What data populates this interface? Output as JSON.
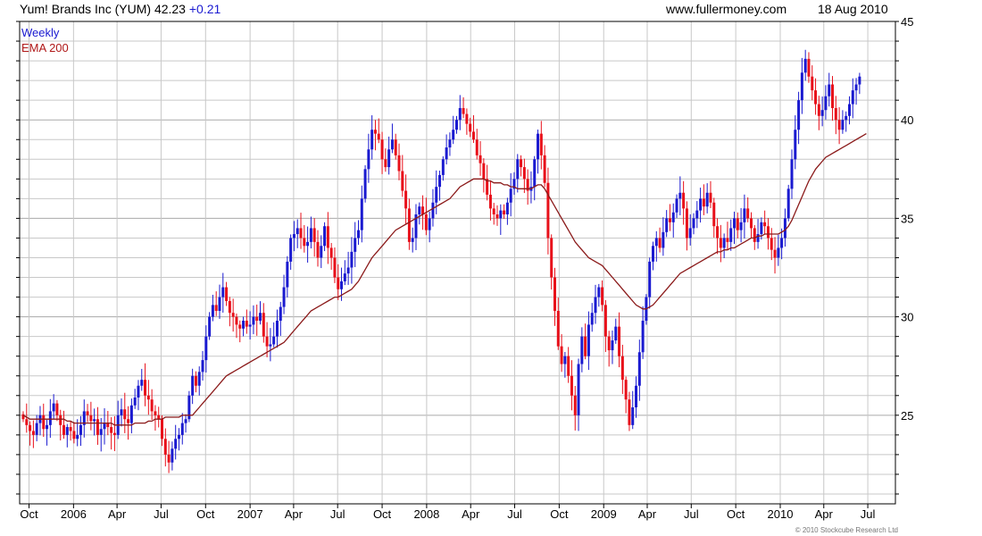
{
  "header": {
    "title": "Yum! Brands Inc (YUM)",
    "price": "42.23",
    "change": "+0.21",
    "website": "www.fullermoney.com",
    "date": "18 Aug 2010"
  },
  "legend": [
    {
      "label": "Weekly",
      "color": "#1a1ad0"
    },
    {
      "label": "EMA 200",
      "color": "#b01818"
    }
  ],
  "copyright": "© 2010 Stockcube Research Ltd",
  "colors": {
    "up": "#1a1ad0",
    "down": "#e8101a",
    "ema": "#8b1a1a",
    "grid": "#c8c8c8",
    "grid_major": "#aaaaaa"
  },
  "chart_data": {
    "type": "candlestick",
    "interval": "weekly",
    "x_range": [
      "2005-09-19",
      "2010-08-16"
    ],
    "x_tick_labels": [
      {
        "date": "2005-10-01",
        "label": "Oct"
      },
      {
        "date": "2006-01-01",
        "label": "2006"
      },
      {
        "date": "2006-04-01",
        "label": "Apr"
      },
      {
        "date": "2006-07-01",
        "label": "Jul"
      },
      {
        "date": "2006-10-01",
        "label": "Oct"
      },
      {
        "date": "2007-01-01",
        "label": "2007"
      },
      {
        "date": "2007-04-01",
        "label": "Apr"
      },
      {
        "date": "2007-07-01",
        "label": "Jul"
      },
      {
        "date": "2007-10-01",
        "label": "Oct"
      },
      {
        "date": "2008-01-01",
        "label": "2008"
      },
      {
        "date": "2008-04-01",
        "label": "Apr"
      },
      {
        "date": "2008-07-01",
        "label": "Jul"
      },
      {
        "date": "2008-10-01",
        "label": "Oct"
      },
      {
        "date": "2009-01-01",
        "label": "2009"
      },
      {
        "date": "2009-04-01",
        "label": "Apr"
      },
      {
        "date": "2009-07-01",
        "label": "Jul"
      },
      {
        "date": "2009-10-01",
        "label": "Oct"
      },
      {
        "date": "2010-01-01",
        "label": "2010"
      },
      {
        "date": "2010-04-01",
        "label": "Apr"
      },
      {
        "date": "2010-07-01",
        "label": "Jul"
      }
    ],
    "y_range": [
      20.5,
      45
    ],
    "y_ticks": [
      25,
      30,
      35,
      40,
      45
    ],
    "y_minor_step": 1,
    "y_axis_side": "right",
    "grid": true,
    "legend_position": "top-left",
    "weekly_close_series": {
      "start_date": "2005-09-19",
      "interval_days": 7,
      "closes": [
        24.8,
        24.5,
        24.2,
        24.0,
        24.6,
        25.0,
        24.3,
        24.5,
        25.2,
        25.6,
        25.0,
        24.5,
        24.0,
        24.4,
        24.2,
        23.8,
        24.0,
        24.5,
        25.2,
        25.0,
        24.7,
        24.8,
        24.0,
        24.3,
        24.6,
        24.4,
        24.1,
        24.0,
        25.0,
        25.3,
        24.8,
        24.6,
        25.5,
        25.9,
        26.5,
        26.8,
        26.0,
        25.8,
        25.2,
        25.0,
        24.8,
        23.8,
        23.0,
        22.6,
        23.3,
        23.8,
        24.0,
        24.6,
        24.8,
        26.0,
        27.0,
        26.5,
        27.2,
        27.8,
        29.0,
        30.0,
        30.6,
        30.3,
        31.0,
        31.5,
        30.8,
        30.2,
        30.0,
        29.6,
        29.4,
        29.8,
        29.5,
        29.6,
        30.0,
        29.8,
        30.2,
        29.0,
        28.5,
        28.6,
        29.0,
        29.8,
        30.5,
        31.5,
        32.8,
        34.0,
        34.2,
        34.5,
        34.0,
        33.6,
        33.8,
        34.5,
        33.8,
        33.0,
        33.6,
        34.6,
        33.5,
        33.0,
        32.0,
        31.4,
        31.8,
        32.2,
        32.5,
        33.3,
        34.0,
        34.4,
        36.0,
        37.5,
        38.5,
        39.5,
        39.3,
        39.0,
        38.0,
        37.6,
        38.5,
        39.0,
        38.2,
        37.4,
        36.4,
        35.5,
        33.8,
        34.0,
        35.2,
        35.6,
        35.2,
        34.4,
        35.0,
        35.8,
        36.6,
        37.2,
        38.0,
        38.6,
        39.0,
        39.5,
        40.0,
        40.6,
        40.3,
        39.8,
        39.4,
        39.0,
        38.2,
        37.8,
        37.0,
        36.2,
        35.5,
        35.2,
        35.0,
        35.4,
        35.2,
        35.8,
        36.5,
        37.0,
        38.0,
        37.6,
        37.0,
        36.4,
        36.6,
        38.0,
        39.3,
        38.2,
        36.8,
        34.0,
        32.0,
        30.3,
        28.5,
        27.6,
        28.0,
        27.0,
        26.0,
        25.0,
        27.6,
        29.0,
        28.0,
        29.6,
        30.2,
        31.0,
        31.5,
        30.6,
        29.0,
        28.3,
        28.8,
        29.5,
        28.0,
        26.8,
        25.8,
        24.5,
        25.4,
        26.5,
        28.2,
        29.8,
        31.0,
        32.8,
        33.6,
        34.0,
        33.5,
        34.3,
        35.0,
        34.8,
        35.3,
        36.0,
        36.3,
        35.5,
        34.0,
        34.5,
        35.0,
        35.4,
        36.0,
        35.6,
        36.3,
        35.8,
        34.6,
        34.0,
        33.5,
        34.0,
        33.8,
        34.5,
        35.0,
        34.4,
        34.8,
        35.5,
        35.0,
        34.5,
        33.8,
        34.2,
        34.8,
        34.6,
        34.0,
        33.4,
        33.0,
        33.5,
        34.0,
        35.0,
        36.5,
        38.0,
        39.5,
        41.0,
        42.4,
        43.1,
        42.2,
        41.5,
        40.8,
        40.2,
        40.5,
        41.2,
        41.8,
        40.6,
        40.0,
        39.5,
        40.0,
        40.2,
        40.8,
        41.5,
        41.8,
        42.2
      ],
      "ema_200": [
        25.0,
        24.9,
        24.8,
        24.8,
        24.8,
        24.8,
        24.8,
        24.8,
        24.8,
        24.8,
        24.8,
        24.8,
        24.8,
        24.7,
        24.7,
        24.6,
        24.6,
        24.6,
        24.6,
        24.6,
        24.6,
        24.6,
        24.6,
        24.6,
        24.6,
        24.6,
        24.6,
        24.5,
        24.5,
        24.5,
        24.5,
        24.5,
        24.5,
        24.6,
        24.6,
        24.6,
        24.6,
        24.7,
        24.7,
        24.8,
        24.8,
        24.8,
        24.9,
        24.9,
        24.9,
        24.9,
        24.9,
        25.0,
        25.0,
        25.0,
        25.0,
        25.2,
        25.4,
        25.6,
        25.8,
        26.0,
        26.2,
        26.4,
        26.6,
        26.8,
        27.0,
        27.1,
        27.2,
        27.3,
        27.4,
        27.5,
        27.6,
        27.7,
        27.8,
        27.9,
        28.0,
        28.1,
        28.2,
        28.3,
        28.4,
        28.5,
        28.6,
        28.7,
        28.9,
        29.1,
        29.3,
        29.5,
        29.7,
        29.9,
        30.1,
        30.3,
        30.4,
        30.5,
        30.6,
        30.7,
        30.8,
        30.9,
        31.0,
        31.0,
        31.1,
        31.2,
        31.3,
        31.4,
        31.6,
        31.8,
        32.1,
        32.4,
        32.7,
        33.0,
        33.2,
        33.4,
        33.6,
        33.8,
        34.0,
        34.2,
        34.4,
        34.5,
        34.6,
        34.7,
        34.8,
        34.9,
        35.0,
        35.1,
        35.2,
        35.3,
        35.4,
        35.5,
        35.6,
        35.7,
        35.8,
        35.9,
        36.0,
        36.2,
        36.4,
        36.6,
        36.7,
        36.8,
        36.9,
        37.0,
        37.0,
        37.0,
        37.0,
        36.9,
        36.9,
        36.8,
        36.8,
        36.8,
        36.7,
        36.7,
        36.6,
        36.6,
        36.5,
        36.5,
        36.5,
        36.5,
        36.5,
        36.6,
        36.7,
        36.7,
        36.5,
        36.2,
        35.9,
        35.6,
        35.3,
        35.0,
        34.7,
        34.4,
        34.1,
        33.8,
        33.6,
        33.4,
        33.2,
        33.0,
        32.9,
        32.8,
        32.7,
        32.6,
        32.4,
        32.2,
        32.0,
        31.8,
        31.6,
        31.4,
        31.2,
        31.0,
        30.8,
        30.6,
        30.5,
        30.4,
        30.4,
        30.5,
        30.6,
        30.8,
        31.0,
        31.2,
        31.4,
        31.6,
        31.8,
        32.0,
        32.2,
        32.3,
        32.4,
        32.5,
        32.6,
        32.7,
        32.8,
        32.9,
        33.0,
        33.1,
        33.2,
        33.3,
        33.3,
        33.4,
        33.4,
        33.5,
        33.5,
        33.6,
        33.7,
        33.8,
        33.9,
        34.0,
        34.0,
        34.1,
        34.1,
        34.2,
        34.2,
        34.2,
        34.2,
        34.2,
        34.3,
        34.4,
        34.6,
        34.9,
        35.3,
        35.7,
        36.1,
        36.5,
        36.9,
        37.2,
        37.5,
        37.7,
        37.9,
        38.1,
        38.2,
        38.3,
        38.4,
        38.5,
        38.6,
        38.7,
        38.8,
        38.9,
        39.0,
        39.1,
        39.2,
        39.3
      ]
    }
  }
}
